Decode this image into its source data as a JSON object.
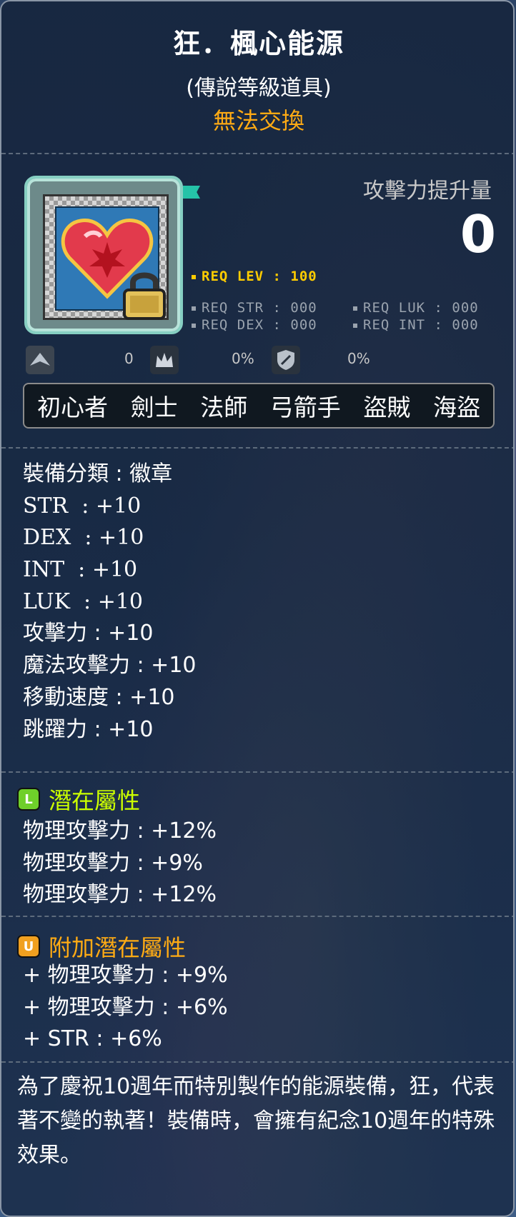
{
  "item": {
    "name": "狂．楓心能源",
    "grade": "(傳說等級道具)",
    "trade_status": "無法交換",
    "icon": "heart-emblem-icon"
  },
  "attack_increase": {
    "label": "攻擊力提升量",
    "value": "0"
  },
  "requirements": {
    "lev": "REQ LEV : 100",
    "str": "REQ STR : 000",
    "luk": "REQ LUK : 000",
    "dex": "REQ DEX : 000",
    "int": "REQ INT : 000"
  },
  "small_stats": {
    "first": "0",
    "second": "0%",
    "third": "0%"
  },
  "jobs": [
    "初心者",
    "劍士",
    "法師",
    "弓箭手",
    "盜賊",
    "海盜"
  ],
  "stats": [
    "裝備分類 : 徽章",
    "STR  : +10",
    "DEX  : +10",
    "INT  : +10",
    "LUK  : +10",
    "攻擊力 : +10",
    "魔法攻擊力 : +10",
    "移動速度 : +10",
    "跳躍力 : +10"
  ],
  "potential": {
    "grade_letter": "L",
    "title": "潛在屬性",
    "title_color": "#ccff00",
    "lines": [
      "物理攻擊力 : +12%",
      "物理攻擊力 : +9%",
      "物理攻擊力 : +12%"
    ]
  },
  "additional_potential": {
    "grade_letter": "U",
    "title": "附加潛在屬性",
    "title_color": "#ffab14",
    "lines": [
      "+ 物理攻擊力 : +9%",
      "+ 物理攻擊力 : +6%",
      "+ STR : +6%"
    ]
  },
  "description": "為了慶祝10週年而特別製作的能源裝備，狂，代表著不變的執著！裝備時，會擁有紀念10週年的特殊效果。"
}
